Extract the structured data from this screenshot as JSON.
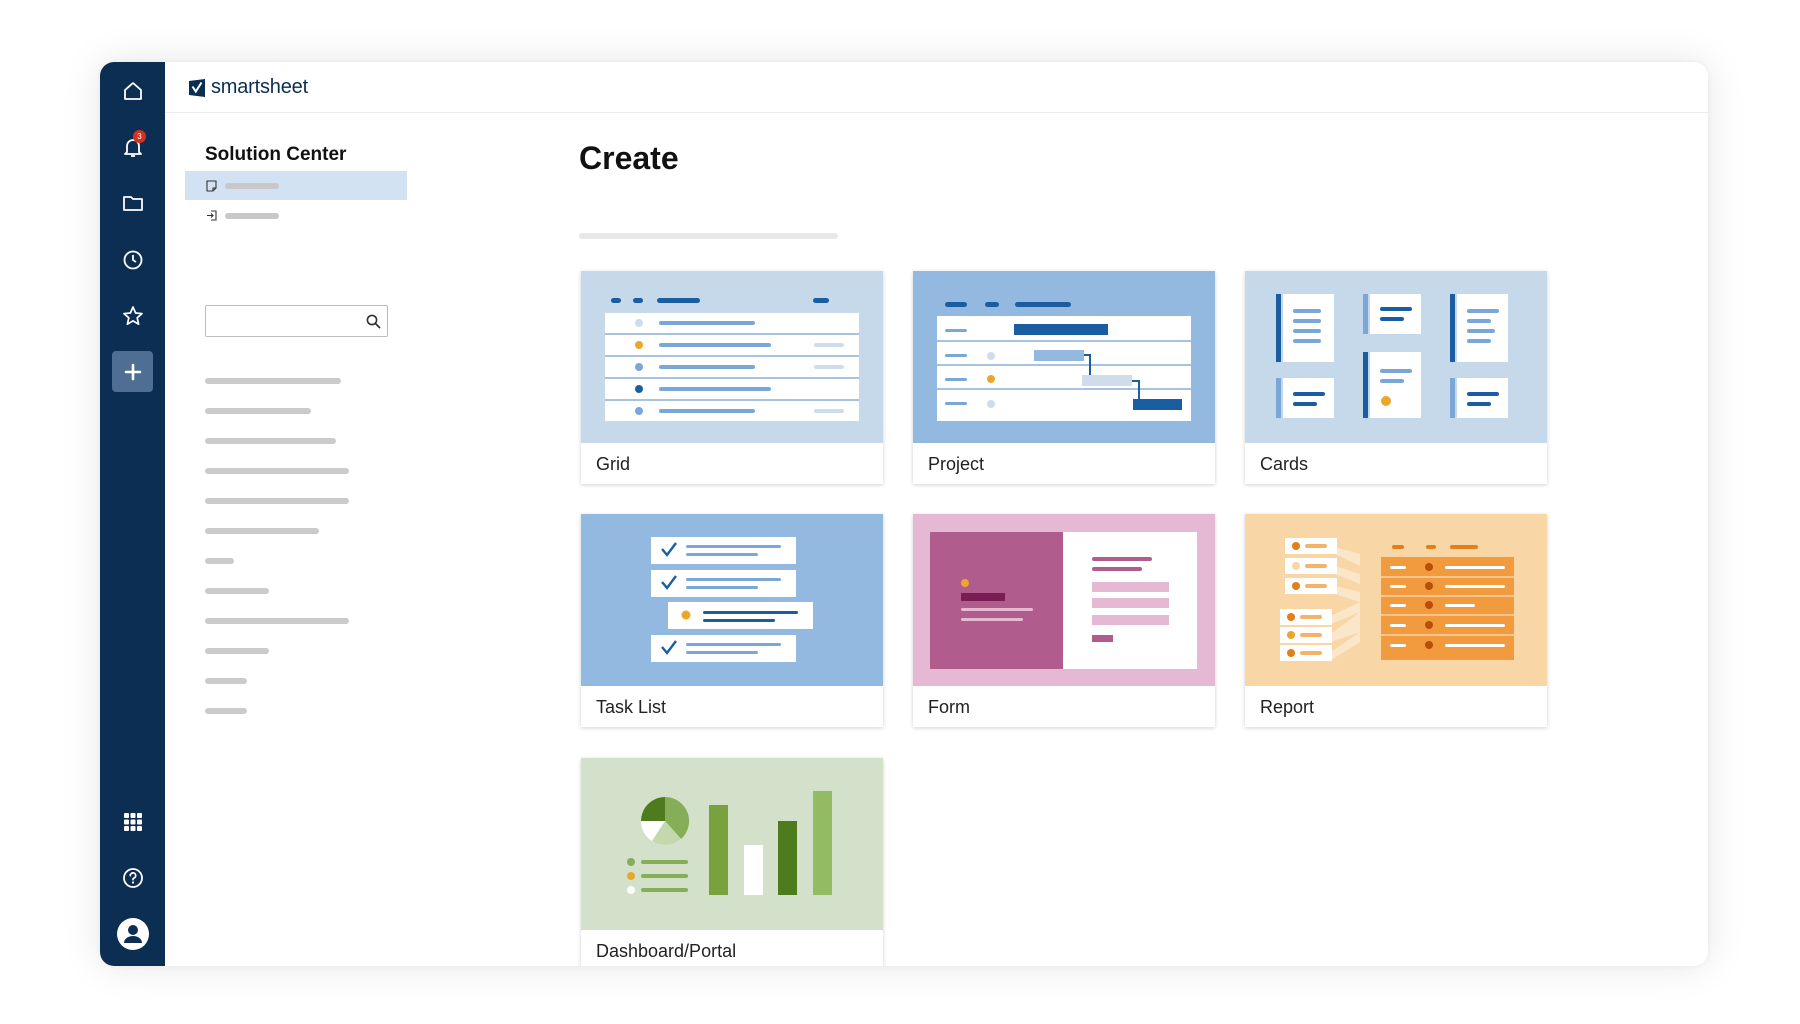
{
  "app": {
    "logo_text": "smartsheet"
  },
  "nav_rail": {
    "items": [
      {
        "icon": "home-icon"
      },
      {
        "icon": "bell-icon",
        "badge": "3"
      },
      {
        "icon": "folder-icon"
      },
      {
        "icon": "clock-icon"
      },
      {
        "icon": "star-icon"
      },
      {
        "icon": "plus-icon",
        "active": true
      }
    ],
    "bottom_items": [
      {
        "icon": "app-grid-icon"
      },
      {
        "icon": "help-icon"
      },
      {
        "icon": "account-icon"
      }
    ]
  },
  "side_panel": {
    "title": "Solution Center",
    "search": {
      "placeholder": "",
      "value": ""
    }
  },
  "main": {
    "title": "Create",
    "cards": [
      {
        "label": "Grid",
        "illustration": "grid-illustration",
        "bg": "#c6d9ea"
      },
      {
        "label": "Project",
        "illustration": "project-illustration",
        "bg": "#94b9e0"
      },
      {
        "label": "Cards",
        "illustration": "cards-illustration",
        "bg": "#c6d9ea"
      },
      {
        "label": "Task List",
        "illustration": "task-list-illustration",
        "bg": "#94b9e0"
      },
      {
        "label": "Form",
        "illustration": "form-illustration",
        "bg": "#e5b9d3"
      },
      {
        "label": "Report",
        "illustration": "report-illustration",
        "bg": "#f8d6a6"
      },
      {
        "label": "Dashboard/Portal",
        "illustration": "dashboard-illustration",
        "bg": "#d3e1cb"
      }
    ]
  },
  "colors": {
    "rail": "#0c2e52",
    "rail_active": "#4e6f93",
    "selected_row": "#d3e2f2",
    "badge": "#d6311f"
  }
}
